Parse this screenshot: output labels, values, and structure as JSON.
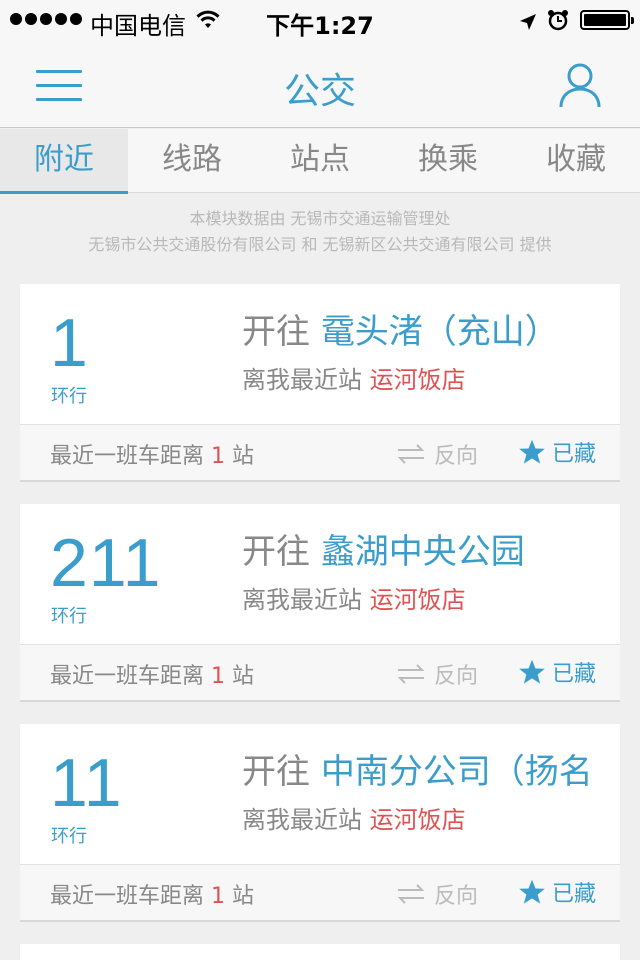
{
  "status_bar": {
    "carrier": "中国电信",
    "time": "下午1:27",
    "battery_level": 1.0
  },
  "nav": {
    "title": "公交",
    "menu_icon": "hamburger-icon",
    "user_icon": "user-icon"
  },
  "tabs": [
    {
      "label": "附近",
      "active": true
    },
    {
      "label": "线路",
      "active": false
    },
    {
      "label": "站点",
      "active": false
    },
    {
      "label": "换乘",
      "active": false
    },
    {
      "label": "收藏",
      "active": false
    }
  ],
  "notice": {
    "line1": "本模块数据由 无锡市交通运输管理处",
    "line2": "无锡市公共交通股份有限公司 和 无锡新区公共交通有限公司 提供"
  },
  "cards": [
    {
      "route": "1",
      "tag": "环行",
      "dest_prefix": "开往 ",
      "dest": "鼋头渚（充山）",
      "station_prefix": "离我最近站 ",
      "station": "运河饭店",
      "dist_prefix": "最近一班车距离 ",
      "dist_count": "1",
      "dist_suffix": " 站",
      "reverse": "反向",
      "fav": "已藏"
    },
    {
      "route": "211",
      "tag": "环行",
      "dest_prefix": "开往 ",
      "dest": "蠡湖中央公园",
      "station_prefix": "离我最近站 ",
      "station": "运河饭店",
      "dist_prefix": "最近一班车距离 ",
      "dist_count": "1",
      "dist_suffix": " 站",
      "reverse": "反向",
      "fav": "已藏"
    },
    {
      "route": "11",
      "tag": "环行",
      "dest_prefix": "开往 ",
      "dest": "中南分公司（扬名",
      "station_prefix": "离我最近站 ",
      "station": "运河饭店",
      "dist_prefix": "最近一班车距离 ",
      "dist_count": "1",
      "dist_suffix": " 站",
      "reverse": "反向",
      "fav": "已藏"
    }
  ],
  "colors": {
    "accent": "#3b9dcc",
    "highlight": "#e05252",
    "muted": "#888888"
  }
}
